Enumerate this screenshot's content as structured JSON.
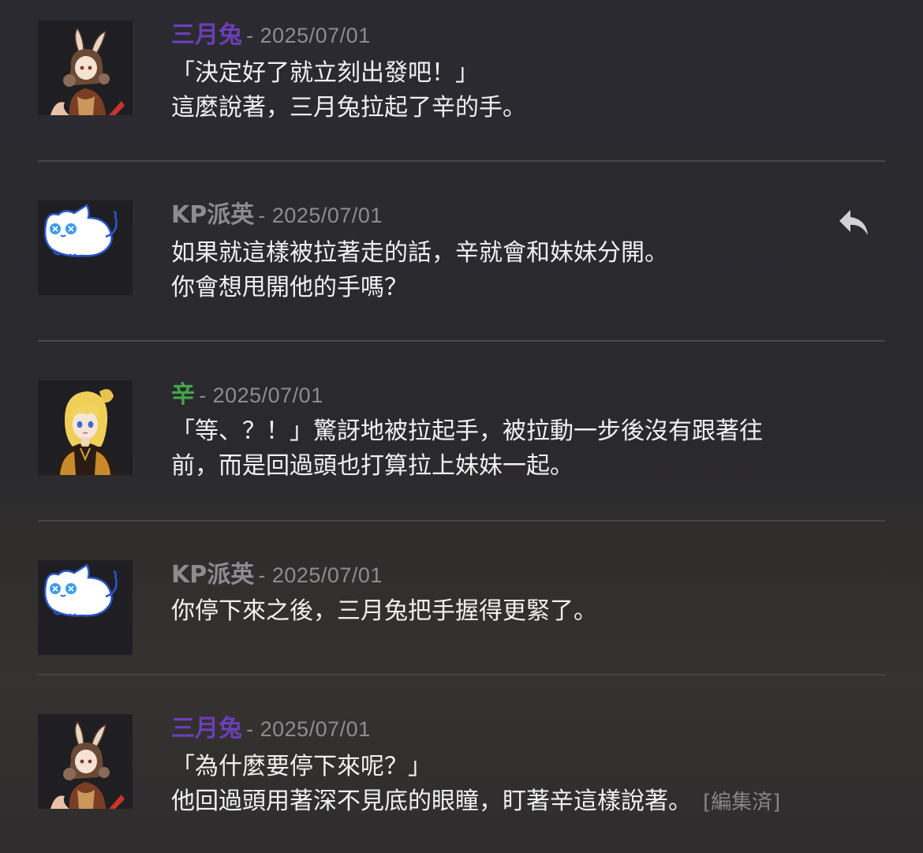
{
  "colors": {
    "sangetsu": "#6b3fb6",
    "kp": "#8c8b90",
    "shin": "#46a44d"
  },
  "messages": [
    {
      "name": "三月兔",
      "date": "- 2025/07/01",
      "lines": [
        "「決定好了就立刻出發吧！」",
        "這麼說著，三月兔拉起了辛的手。"
      ]
    },
    {
      "name": "KP派英",
      "date": "- 2025/07/01",
      "lines": [
        "如果就這樣被拉著走的話，辛就會和妹妹分開。",
        "你會想甩開他的手嗎？"
      ]
    },
    {
      "name": "辛",
      "date": "- 2025/07/01",
      "lines": [
        "「等、？！」驚訝地被拉起手，被拉動一步後沒有跟著往",
        "前，而是回過頭也打算拉上妹妹一起。"
      ]
    },
    {
      "name": "KP派英",
      "date": "- 2025/07/01",
      "lines": [
        "你停下來之後，三月兔把手握得更緊了。"
      ]
    },
    {
      "name": "三月兔",
      "date": "- 2025/07/01",
      "lines": [
        "「為什麼要停下來呢？」",
        "他回過頭用著深不見底的眼瞳，盯著辛這樣說著。"
      ],
      "edited": "[編集済]"
    }
  ],
  "icons": {
    "reply": "reply-arrow-icon",
    "avatar_sangetsu": "bunny-girl-avatar",
    "avatar_kp": "white-cat-avatar",
    "avatar_shin": "blonde-boy-avatar"
  }
}
